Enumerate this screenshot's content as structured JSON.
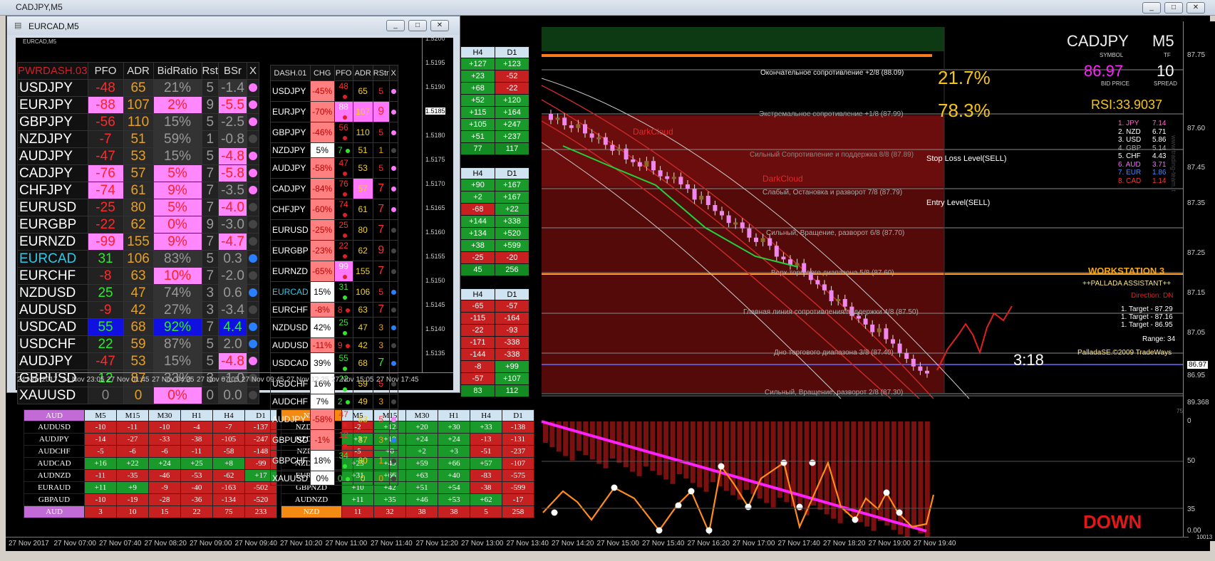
{
  "window": {
    "title": "CADJPY,M5"
  },
  "overlay_window": {
    "title": "EURCAD,M5"
  },
  "main_chart": {
    "symbol": "CADJPY",
    "timeframe": "M5",
    "symbol_caption": "SYMBOL",
    "tf_caption": "TF",
    "bid": "86.97",
    "bid_caption": "BID PRICE",
    "spread": "10",
    "spread_caption": "SPREAD",
    "rsi": "RSI:33.9037",
    "pct_top": "21.7%",
    "pct_bottom": "78.3%",
    "timer": "3:18",
    "direction_big": "DOWN",
    "workstation": "WORKSTATION 3",
    "assistant": "++PALLADA ASSISTANT++",
    "direction": "Direction: DN",
    "targets": [
      "1. Target - 87.29",
      "1. Target - 87.16",
      "1. Target - 86.95"
    ],
    "range": "Range: 34",
    "copyright": "PalladaSE.©2009 TradeWays",
    "watermark": "www.trading-team.it",
    "stop_loss": "Stop Loss Level(SELL)",
    "entry": "Entry Level(SELL)",
    "dark_cloud_1": "DarkCloud",
    "dark_cloud_2": "DarkCloud",
    "levels": [
      "Окончательное сопротивление +2/8 (88.09)",
      "Экстремальное сопротивление +1/8 (87.99)",
      "Сильный  Сопротивление и поддержка 8/8 (87.89)",
      "Слабый, Остановка и разворот 7/8 (87.79)",
      "Сильный, Вращение, разворот 6/8 (87.70)",
      "Верх торгового диапазона 5/8 (87.60)",
      "Главная линия сопротивления/поддержки 4/8 (87.50)",
      "Дно торгового диапазона 3/8 (87.40)",
      "Сильный, Вращение, разворот 2/8 (87.30)"
    ],
    "strength": [
      {
        "rank": "1.",
        "cur": "JPY",
        "val": "7.14",
        "color": "#ff66cc"
      },
      {
        "rank": "2.",
        "cur": "NZD",
        "val": "6.71",
        "color": "#ffffff"
      },
      {
        "rank": "3.",
        "cur": "USD",
        "val": "5.86",
        "color": "#ffffff"
      },
      {
        "rank": "4.",
        "cur": "GBP",
        "val": "5.14",
        "color": "#aaaaaa"
      },
      {
        "rank": "5.",
        "cur": "CHF",
        "val": "4.43",
        "color": "#ffffff"
      },
      {
        "rank": "6.",
        "cur": "AUD",
        "val": "3.71",
        "color": "#ff66ff"
      },
      {
        "rank": "7.",
        "cur": "EUR",
        "val": "1.86",
        "color": "#4488ff"
      },
      {
        "rank": "8.",
        "cur": "CAD",
        "val": "1.14",
        "color": "#ff3333"
      }
    ],
    "price_axis": [
      "87.75",
      "87.60",
      "87.45",
      "87.35",
      "87.25",
      "87.15",
      "87.05",
      "86.97",
      "86.95"
    ],
    "indicator_axis": [
      "89.368",
      "0",
      "50",
      "35",
      "0.00"
    ],
    "indicator_corner": "10013",
    "indicator_top": "75"
  },
  "time_axis": [
    "27 Nov 2017",
    "27 Nov 07:00",
    "27 Nov 07:40",
    "27 Nov 08:20",
    "27 Nov 09:00",
    "27 Nov 09:40",
    "27 Nov 10:20",
    "27 Nov 11:00",
    "27 Nov 11:40",
    "27 Nov 12:20",
    "27 Nov 13:00",
    "27 Nov 13:40",
    "27 Nov 14:20",
    "27 Nov 15:00",
    "27 Nov 15:40",
    "27 Nov 16:20",
    "27 Nov 17:00",
    "27 Nov 17:40",
    "27 Nov 18:20",
    "27 Nov 19:00",
    "27 Nov 19:40"
  ],
  "overlay_time_axis": [
    "24 Nov 2017",
    "24 Nov 23:05",
    "27 Nov 01:45",
    "27 Nov 04:25",
    "27 Nov 07:05",
    "27 Nov 09:45",
    "27 Nov 12:25",
    "27 Nov 15:05",
    "27 Nov 17:45"
  ],
  "overlay_price_axis": [
    "1.5200",
    "1.5195",
    "1.5190",
    "1.5185",
    "1.5180",
    "1.5175",
    "1.5170",
    "1.5165",
    "1.5160",
    "1.5155",
    "1.5150",
    "1.5145",
    "1.5140",
    "1.5135"
  ],
  "pwrdash": {
    "header": [
      "PWRDASH.03",
      "PFO",
      "ADR",
      "BidRatio",
      "Rst",
      "BSr",
      "X"
    ],
    "rows": [
      [
        "USDJPY",
        "-48",
        "65",
        "21%",
        "5",
        "-1.4"
      ],
      [
        "EURJPY",
        "-88",
        "107",
        "2%",
        "9",
        "-5.5"
      ],
      [
        "GBPJPY",
        "-56",
        "110",
        "15%",
        "5",
        "-2.5"
      ],
      [
        "NZDJPY",
        "-7",
        "51",
        "59%",
        "1",
        "-0.8"
      ],
      [
        "AUDJPY",
        "-47",
        "53",
        "15%",
        "5",
        "-4.8"
      ],
      [
        "CADJPY",
        "-76",
        "57",
        "5%",
        "7",
        "-5.8"
      ],
      [
        "CHFJPY",
        "-74",
        "61",
        "9%",
        "7",
        "-3.5"
      ],
      [
        "EURUSD",
        "-25",
        "80",
        "5%",
        "7",
        "-4.0"
      ],
      [
        "EURGBP",
        "-22",
        "62",
        "0%",
        "9",
        "-3.0"
      ],
      [
        "EURNZD",
        "-99",
        "155",
        "9%",
        "7",
        "-4.7"
      ],
      [
        "EURCAD",
        "31",
        "106",
        "83%",
        "5",
        "0.3"
      ],
      [
        "EURCHF",
        "-8",
        "63",
        "10%",
        "7",
        "-2.0"
      ],
      [
        "NZDUSD",
        "25",
        "47",
        "74%",
        "3",
        "0.6"
      ],
      [
        "AUDUSD",
        "-9",
        "42",
        "27%",
        "3",
        "-3.4"
      ],
      [
        "USDCAD",
        "55",
        "68",
        "92%",
        "7",
        "4.4"
      ],
      [
        "USDCHF",
        "22",
        "59",
        "87%",
        "5",
        "2.0"
      ],
      [
        "AUDJPY",
        "-47",
        "53",
        "15%",
        "5",
        "-4.8"
      ],
      [
        "GBPUSD",
        "12",
        "87",
        "33%",
        "3",
        "-1.0"
      ],
      [
        "XAUUSD",
        "0",
        "0",
        "0%",
        "0",
        "0.0"
      ]
    ]
  },
  "dash01": {
    "header": [
      "DASH.01",
      "CHG",
      "PFO",
      "ADR",
      "RStr",
      "X"
    ],
    "rows": [
      [
        "USDJPY",
        "-45%",
        "48",
        "65",
        "5"
      ],
      [
        "EURJPY",
        "-70%",
        "88",
        "107",
        "9"
      ],
      [
        "GBPJPY",
        "-46%",
        "56",
        "110",
        "5"
      ],
      [
        "NZDJPY",
        "5%",
        "7",
        "51",
        "1"
      ],
      [
        "AUDJPY",
        "-58%",
        "47",
        "53",
        "5"
      ],
      [
        "CADJPY",
        "-84%",
        "76",
        "57",
        "7"
      ],
      [
        "CHFJPY",
        "-60%",
        "74",
        "61",
        "7"
      ],
      [
        "EURUSD",
        "-25%",
        "25",
        "80",
        "7"
      ],
      [
        "EURGBP",
        "-23%",
        "22",
        "62",
        "9"
      ],
      [
        "EURNZD",
        "-65%",
        "99",
        "155",
        "7"
      ],
      [
        "EURCAD",
        "15%",
        "31",
        "106",
        "5"
      ],
      [
        "EURCHF",
        "-8%",
        "8",
        "63",
        "7"
      ],
      [
        "NZDUSD",
        "42%",
        "25",
        "47",
        "3"
      ],
      [
        "AUDUSD",
        "-11%",
        "9",
        "42",
        "3"
      ],
      [
        "USDCAD",
        "39%",
        "55",
        "68",
        "7"
      ],
      [
        "USDCHF",
        "16%",
        "22",
        "59",
        "5"
      ],
      [
        "AUDCHF",
        "7%",
        "2",
        "49",
        "3"
      ],
      [
        "AUDJPY",
        "-58%",
        "47",
        "53",
        "5"
      ],
      [
        "GBPUSD",
        "-1%",
        "12",
        "87",
        "3"
      ],
      [
        "GBPCHF",
        "18%",
        "34",
        "80",
        "1"
      ],
      [
        "XAUUSD",
        "0%",
        "0",
        "0",
        "0"
      ]
    ]
  },
  "mini_tables": [
    {
      "header": [
        "H4",
        "D1"
      ],
      "rows": [
        [
          "+127",
          "+123"
        ],
        [
          "+23",
          "-52"
        ],
        [
          "+68",
          "-22"
        ],
        [
          "+52",
          "+120"
        ],
        [
          "+115",
          "+164"
        ],
        [
          "+105",
          "+247"
        ],
        [
          "+51",
          "+237"
        ],
        [
          "77",
          "117"
        ]
      ]
    },
    {
      "header": [
        "H4",
        "D1"
      ],
      "rows": [
        [
          "+90",
          "+167"
        ],
        [
          "+2",
          "+167"
        ],
        [
          "-68",
          "+22"
        ],
        [
          "+144",
          "+338"
        ],
        [
          "+134",
          "+520"
        ],
        [
          "+38",
          "+599"
        ],
        [
          "-25",
          "-20"
        ],
        [
          "45",
          "256"
        ]
      ]
    },
    {
      "header": [
        "H4",
        "D1"
      ],
      "rows": [
        [
          "-65",
          "-57"
        ],
        [
          "-115",
          "-164"
        ],
        [
          "-22",
          "-93"
        ],
        [
          "-171",
          "-338"
        ],
        [
          "-144",
          "-338"
        ],
        [
          "-8",
          "+99"
        ],
        [
          "-57",
          "+107"
        ],
        [
          "83",
          "112"
        ]
      ]
    }
  ],
  "aud_table": {
    "header": [
      "AUD",
      "M5",
      "M15",
      "M30",
      "H1",
      "H4",
      "D1"
    ],
    "rows": [
      [
        "AUDUSD",
        "-10",
        "-11",
        "-10",
        "-4",
        "-7",
        "-137"
      ],
      [
        "AUDJPY",
        "-14",
        "-27",
        "-33",
        "-38",
        "-105",
        "-247"
      ],
      [
        "AUDCHF",
        "-5",
        "-6",
        "-6",
        "-11",
        "-58",
        "-148"
      ],
      [
        "AUDCAD",
        "+16",
        "+22",
        "+24",
        "+25",
        "+8",
        "-99"
      ],
      [
        "AUDNZD",
        "-11",
        "-35",
        "-46",
        "-53",
        "-62",
        "+17"
      ],
      [
        "EURAUD",
        "+11",
        "+9",
        "-9",
        "-40",
        "-163",
        "-502"
      ],
      [
        "GBPAUD",
        "-10",
        "-19",
        "-28",
        "-36",
        "-134",
        "-520"
      ]
    ],
    "footer": [
      "AUD",
      "3",
      "10",
      "15",
      "22",
      "75",
      "233"
    ]
  },
  "nzd_table": {
    "header": [
      "NZD",
      "M5",
      "M15",
      "M30",
      "H1",
      "H4",
      "D1"
    ],
    "rows": [
      [
        "NZDUSD",
        "-2",
        "+12",
        "+20",
        "+30",
        "+33",
        "-138"
      ],
      [
        "NZDCHF",
        "+3",
        "+18",
        "+24",
        "+24",
        "-13",
        "-131"
      ],
      [
        "NZDJPY",
        "-5",
        "+0",
        "+2",
        "+3",
        "-51",
        "-237"
      ],
      [
        "NZDCAD",
        "+25",
        "+49",
        "+59",
        "+66",
        "+57",
        "-107"
      ],
      [
        "EURNZD",
        "+31",
        "+66",
        "+63",
        "+40",
        "-83",
        "-575"
      ],
      [
        "GBPNZD",
        "+10",
        "+42",
        "+51",
        "+54",
        "-38",
        "-599"
      ],
      [
        "AUDNZD",
        "+11",
        "+35",
        "+46",
        "+53",
        "+62",
        "-17"
      ]
    ],
    "footer": [
      "NZD",
      "11",
      "32",
      "38",
      "38",
      "5",
      "258"
    ]
  },
  "colors": {
    "up": "#1fae3a",
    "down": "#cc2222",
    "accent_gold": "#f5c518",
    "pink": "#ff77ff"
  }
}
